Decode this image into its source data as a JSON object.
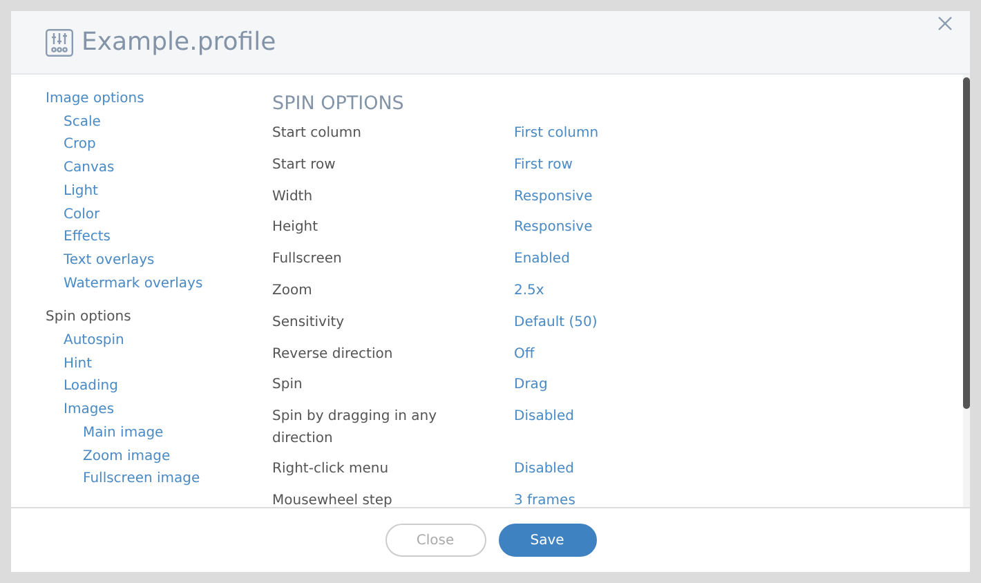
{
  "window": {
    "title": "Example.profile"
  },
  "sidebar": {
    "items": [
      {
        "label": "Image options",
        "selected": false,
        "children": [
          {
            "label": "Scale",
            "selected": false
          },
          {
            "label": "Crop",
            "selected": false
          },
          {
            "label": "Canvas",
            "selected": false
          },
          {
            "label": "Light",
            "selected": false
          },
          {
            "label": "Color",
            "selected": false
          },
          {
            "label": "Effects",
            "selected": false
          },
          {
            "label": "Text overlays",
            "selected": false
          },
          {
            "label": "Watermark overlays",
            "selected": false
          }
        ]
      },
      {
        "label": "Spin options",
        "selected": true,
        "children": [
          {
            "label": "Autospin",
            "selected": false
          },
          {
            "label": "Hint",
            "selected": false
          },
          {
            "label": "Loading",
            "selected": false
          },
          {
            "label": "Images",
            "selected": false,
            "children": [
              {
                "label": "Main image",
                "selected": false
              },
              {
                "label": "Zoom image",
                "selected": false
              },
              {
                "label": "Fullscreen image",
                "selected": false
              }
            ]
          }
        ]
      }
    ]
  },
  "section": {
    "title": "SPIN OPTIONS",
    "settings": [
      {
        "label": "Start column",
        "value": "First column"
      },
      {
        "label": "Start row",
        "value": "First row"
      },
      {
        "label": "Width",
        "value": "Responsive"
      },
      {
        "label": "Height",
        "value": "Responsive"
      },
      {
        "label": "Fullscreen",
        "value": "Enabled"
      },
      {
        "label": "Zoom",
        "value": "2.5x"
      },
      {
        "label": "Sensitivity",
        "value": "Default (50)"
      },
      {
        "label": "Reverse direction",
        "value": "Off"
      },
      {
        "label": "Spin",
        "value": "Drag"
      },
      {
        "label": "Spin by dragging in any direction",
        "value": "Disabled"
      },
      {
        "label": "Right-click menu",
        "value": "Disabled"
      },
      {
        "label": "Mousewheel step",
        "value": "3 frames"
      }
    ]
  },
  "buttons": [
    {
      "label": "Close",
      "kind": "secondary"
    },
    {
      "label": "Save",
      "kind": "primary"
    }
  ]
}
